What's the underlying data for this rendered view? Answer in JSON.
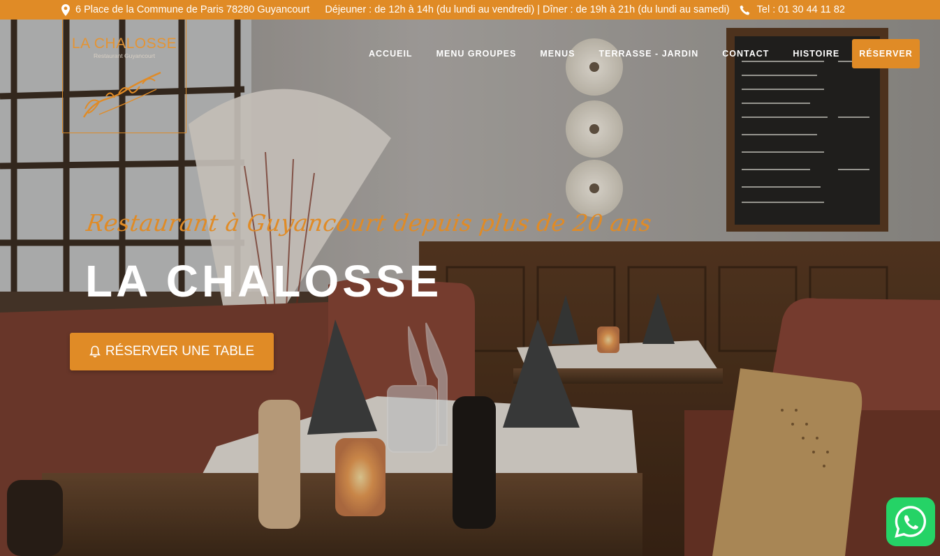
{
  "topbar": {
    "address": "6 Place de la Commune de Paris 78280 Guyancourt",
    "hours": "Déjeuner : de 12h à 14h (du lundi au vendredi) | Dîner : de 19h à 21h (du lundi au samedi)",
    "phone": "Tel : 01 30 44 11 82",
    "background_color": "#e08b26",
    "address_icon": "map-marker-icon",
    "phone_icon": "phone-icon"
  },
  "logo": {
    "name": "LA CHALOSSE",
    "subtitle": "Restaurant Guyancourt",
    "signature_text": "C'est Sud-Ouest"
  },
  "nav": {
    "items": [
      {
        "label": "ACCUEIL"
      },
      {
        "label": "MENU GROUPES"
      },
      {
        "label": "MENUS"
      },
      {
        "label": "TERRASSE - JARDIN"
      },
      {
        "label": "CONTACT"
      },
      {
        "label": "HISTOIRE"
      }
    ],
    "reserve_label": "RÉSERVER",
    "accent_color": "#e08b26"
  },
  "hero": {
    "tagline": "Restaurant à Guyancourt depuis plus de 20 ans",
    "headline": "LA CHALOSSE",
    "cta_label": "RÉSERVER UNE TABLE",
    "cta_icon": "bell-icon"
  },
  "whatsapp": {
    "icon": "whatsapp-icon",
    "color": "#25d366"
  }
}
